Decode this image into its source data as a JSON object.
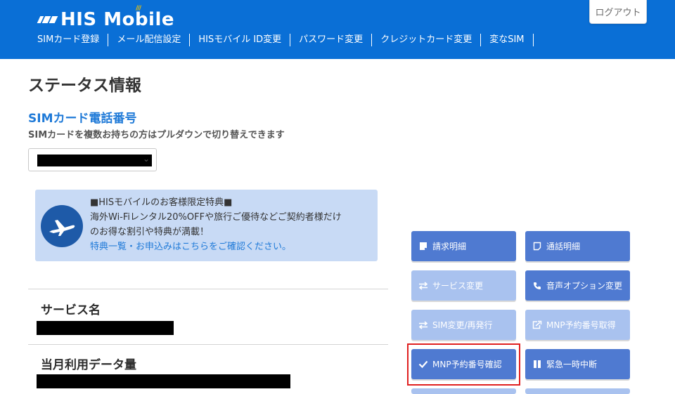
{
  "header": {
    "logo_text": "HIS Mobile",
    "nav": [
      "SIMカード登録",
      "メール配信設定",
      "HISモバイル ID変更",
      "パスワード変更",
      "クレジットカード変更",
      "変なSIM"
    ],
    "logout_label": "ログアウト"
  },
  "main": {
    "page_title": "ステータス情報",
    "sim_title": "SIMカード電話番号",
    "sim_subtitle": "SIMカードを複数お持ちの方はプルダウンで切り替えできます"
  },
  "promo": {
    "line1": "■HISモバイルのお客様限定特典■",
    "line2": "海外Wi-Fiレンタル20%OFFや旅行ご優待などご契約者様だけ",
    "line3": "のお得な割引や特典が満載！",
    "link": "特典一覧・お申込みはこちらをご確認ください。"
  },
  "fields": {
    "service_name_label": "サービス名",
    "data_usage_label": "当月利用データ量"
  },
  "buttons": {
    "billing": "請求明細",
    "call_detail": "通話明細",
    "service_change": "サービス変更",
    "voice_option": "音声オプション変更",
    "sim_reissue": "SIM変更/再発行",
    "mnp_get": "MNP予約番号取得",
    "mnp_confirm": "MNP予約番号確認",
    "suspend": "緊急一時中断"
  },
  "colors": {
    "header_bg": "#0a6fd6",
    "button_active": "#4f7ad1",
    "button_disabled": "#a9c2ef",
    "highlight": "#e02020"
  }
}
